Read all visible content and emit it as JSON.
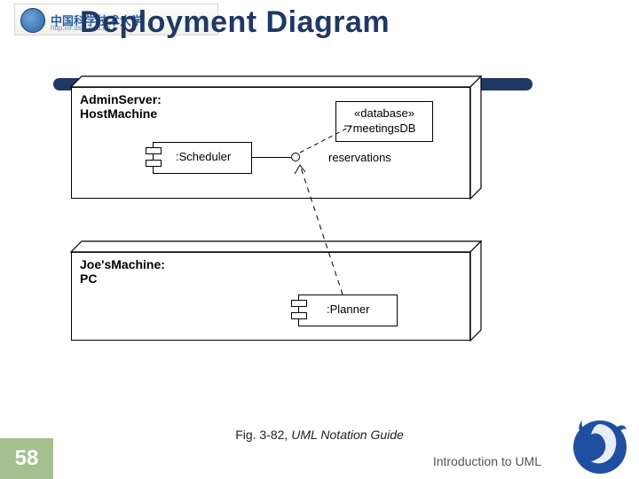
{
  "logo": {
    "text": "中国科学技术大学",
    "url": "http://if.ustc.edu.cn"
  },
  "title": "Deployment Diagram",
  "diagram": {
    "node1": {
      "label": "AdminServer: HostMachine"
    },
    "node2": {
      "label": "Joe'sMachine: PC"
    },
    "scheduler": {
      "label": ":Scheduler"
    },
    "planner": {
      "label": ":Planner"
    },
    "database": {
      "stereotype": "«database»",
      "name": "meetingsDB"
    },
    "interface": {
      "label": "reservations"
    }
  },
  "caption": {
    "fig": "Fig. 3-82, ",
    "src": "UML Notation Guide"
  },
  "footer": "Introduction to UML",
  "slide_number": "58"
}
